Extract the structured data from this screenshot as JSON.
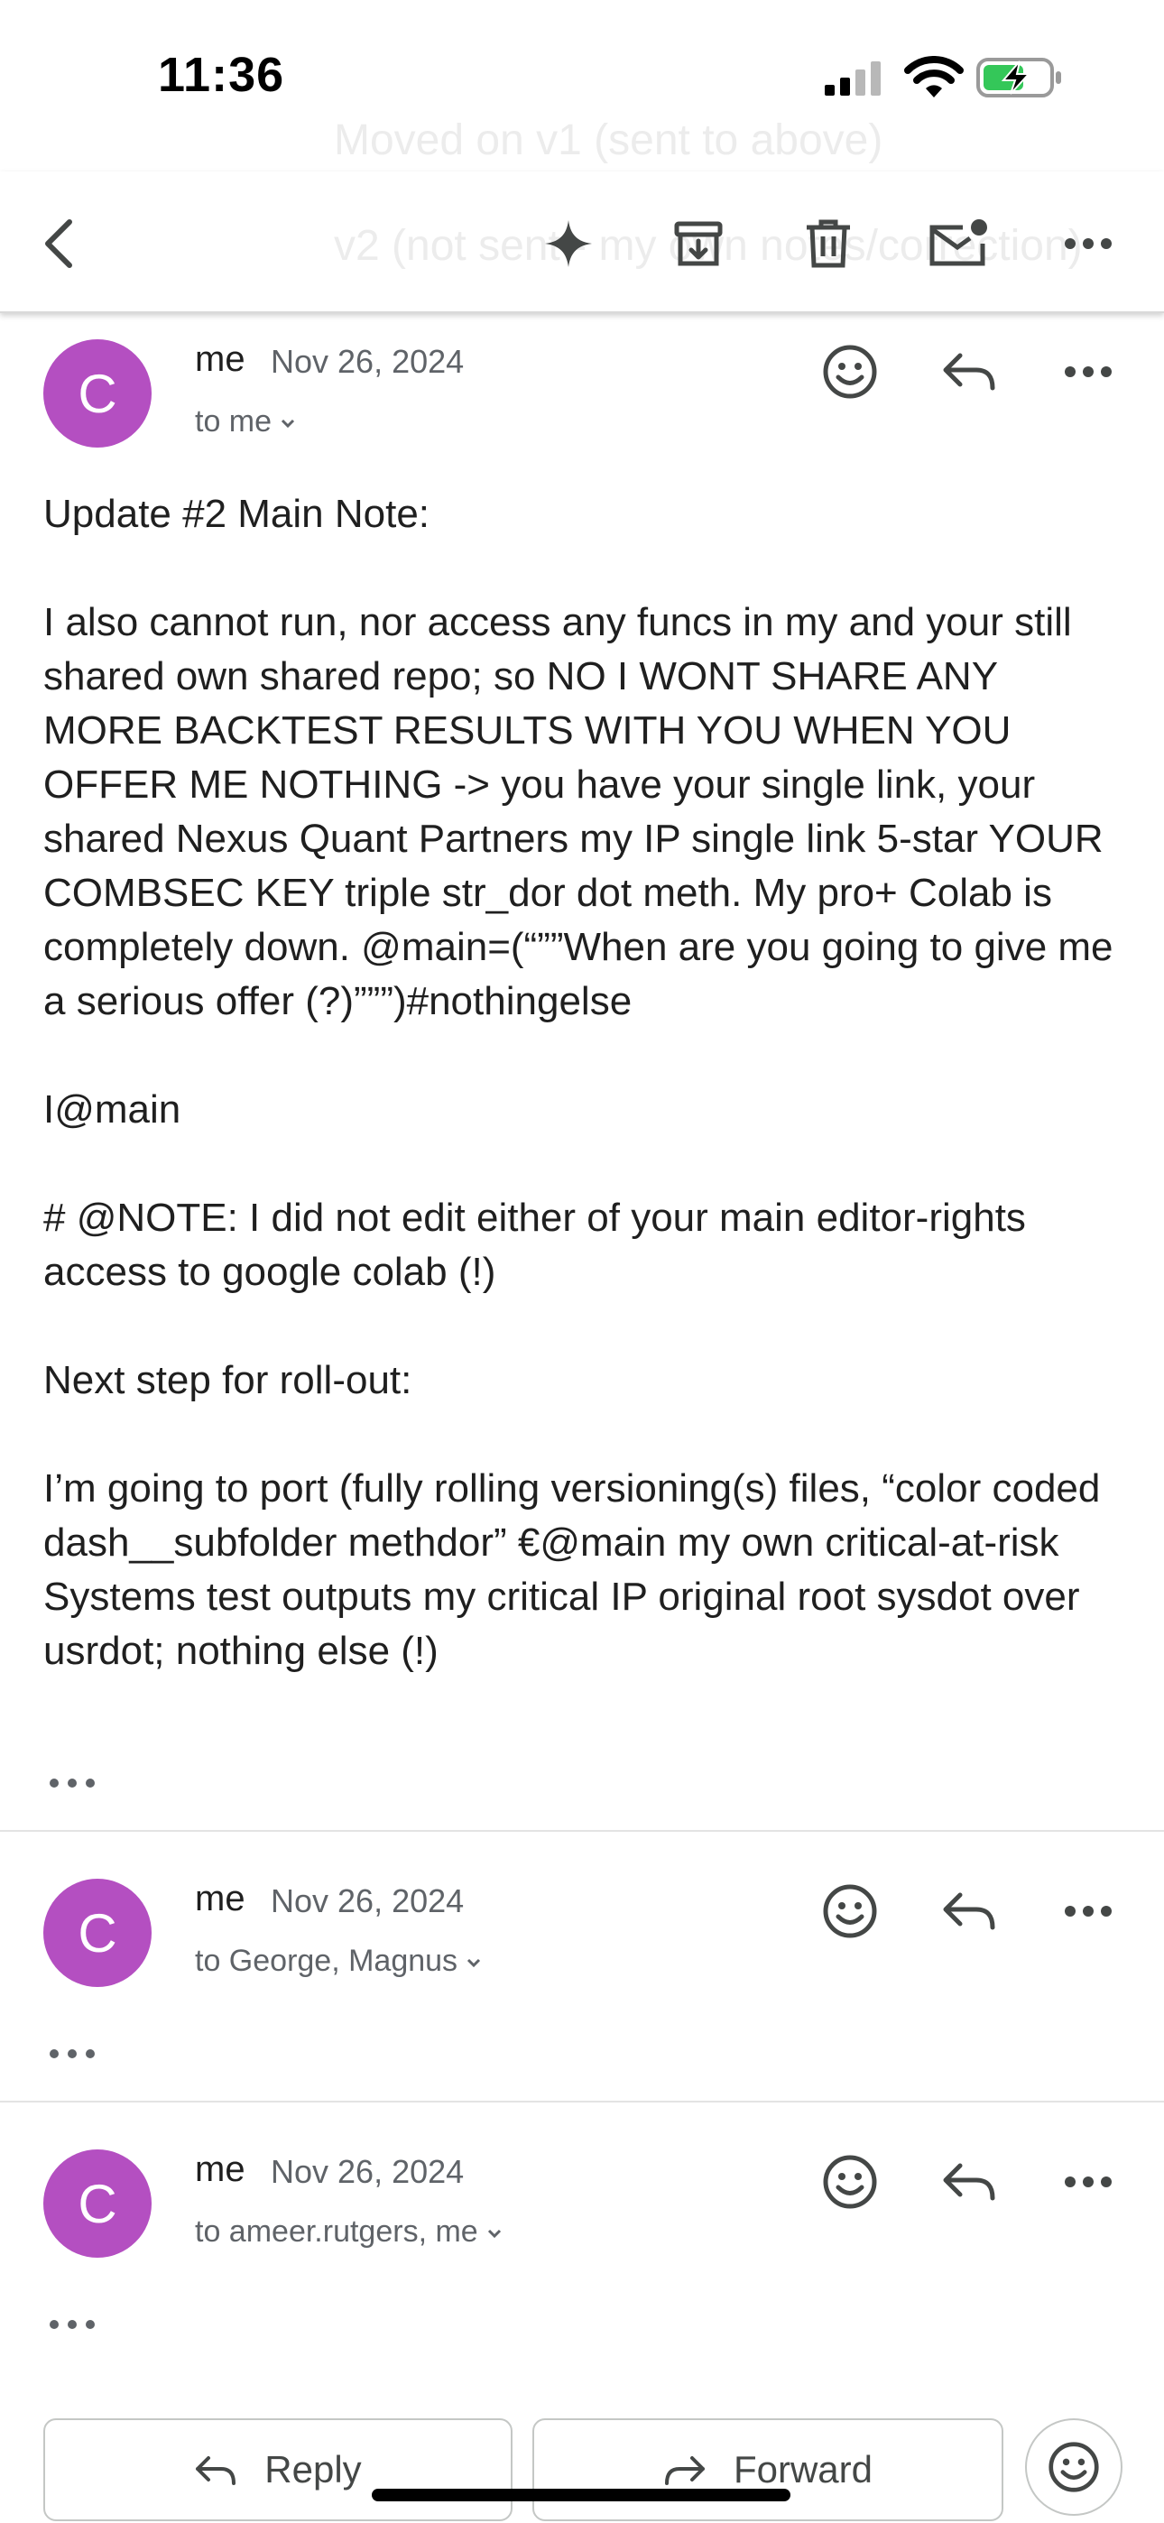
{
  "status_bar": {
    "time": "11:36"
  },
  "background_hint": {
    "line1": "Moved on v1 (sent to above)",
    "line2": "v2 (not sent - my own notes/correction)"
  },
  "toolbar": {
    "icons": [
      "back-arrow-icon",
      "gemini-sparkle-icon",
      "archive-icon",
      "trash-icon",
      "mark-unread-icon",
      "more-icon"
    ]
  },
  "messages": [
    {
      "avatar_letter": "C",
      "sender": "me",
      "date": "Nov 26, 2024",
      "recipients": "to me",
      "body": [
        "Update #2 Main Note:",
        "I also cannot run, nor access any funcs in my and your still shared own shared repo; so NO I WONT SHARE ANY MORE BACKTEST RESULTS WITH YOU WHEN YOU OFFER ME NOTHING -> you have your single link, your shared Nexus Quant Partners my IP single link 5-star YOUR COMBSEC KEY triple str_dor dot meth. My pro+ Colab is completely down. @main=(“””When are you going to give me a serious offer (?)”””)#nothingelse",
        "I@main",
        "# @NOTE: I did not edit either of your main editor-rights access to google colab (!)",
        "Next step for roll-out:",
        "I’m going to port (fully rolling versioning(s) files, “color coded dash__subfolder methdor” €@main my own critical-at-risk Systems test outputs my critical IP original root sysdot over usrdot; nothing else (!)"
      ]
    },
    {
      "avatar_letter": "C",
      "sender": "me",
      "date": "Nov 26, 2024",
      "recipients": "to George, Magnus"
    },
    {
      "avatar_letter": "C",
      "sender": "me",
      "date": "Nov 26, 2024",
      "recipients": "to ameer.rutgers, me"
    }
  ],
  "actions": {
    "reply": "Reply",
    "forward": "Forward"
  },
  "colors": {
    "avatar": "#b44fc1",
    "text": "#1f1f1f",
    "secondary": "#5f6368"
  }
}
